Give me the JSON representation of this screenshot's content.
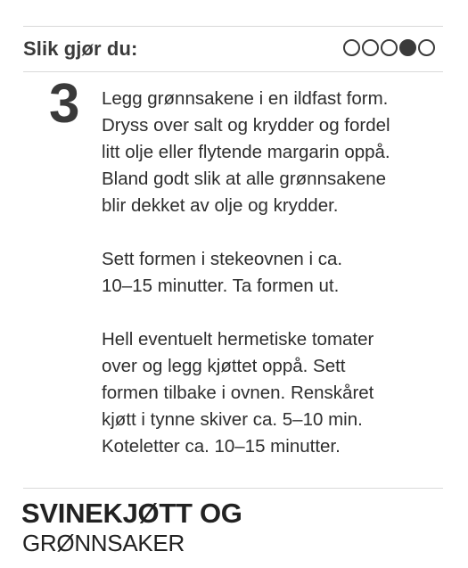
{
  "header": {
    "title": "Slik gjør du:",
    "progress": {
      "total": 5,
      "current": 4
    }
  },
  "step": {
    "number": "3",
    "paragraphs": [
      "Legg grønnsakene i en ildfast form.\nDryss over salt og krydder og fordel\nlitt olje eller flytende margarin oppå.\nBland godt slik at alle grønnsakene\nblir dekket av olje og krydder.",
      "Sett formen i stekeovnen i ca.\n10–15 minutter. Ta formen ut.",
      "Hell eventuelt hermetiske tomater\nover og legg kjøttet oppå. Sett\nformen tilbake i ovnen. Renskåret\nkjøtt i tynne skiver ca. 5–10 min.\nKoteletter ca. 10–15 minutter."
    ]
  },
  "recipe": {
    "title_line1": "SVINEKJØTT OG",
    "title_line2": "GRØNNSAKER"
  }
}
